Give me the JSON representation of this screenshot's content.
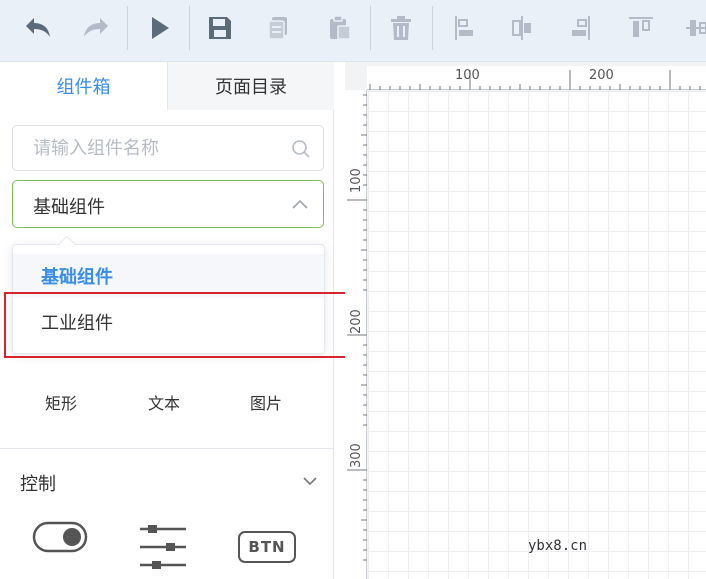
{
  "toolbar": {
    "buttons": [
      {
        "icon": "undo-icon"
      },
      {
        "icon": "redo-icon"
      },
      {
        "icon": "play-icon"
      },
      {
        "icon": "save-icon"
      },
      {
        "icon": "copy-icon"
      },
      {
        "icon": "paste-icon"
      },
      {
        "icon": "delete-icon"
      },
      {
        "icon": "align-left-icon"
      },
      {
        "icon": "align-center-icon"
      },
      {
        "icon": "align-right-icon"
      },
      {
        "icon": "align-top-icon"
      },
      {
        "icon": "align-middle-icon"
      }
    ]
  },
  "left_panel": {
    "tabs": [
      {
        "label": "组件箱",
        "active": true
      },
      {
        "label": "页面目录",
        "active": false
      }
    ],
    "search": {
      "placeholder": "请输入组件名称",
      "value": ""
    },
    "category_select": {
      "value": "基础组件",
      "options": [
        "基础组件",
        "工业组件"
      ],
      "selected_option": "基础组件"
    },
    "basic_components": [
      {
        "label": "矩形",
        "icon": "rectangle-icon"
      },
      {
        "label": "文本",
        "icon": "text-icon"
      },
      {
        "label": "图片",
        "icon": "image-icon"
      }
    ],
    "control_section": {
      "title": "控制",
      "components": [
        {
          "icon": "toggle-switch-icon"
        },
        {
          "icon": "slider-icon"
        },
        {
          "icon": "button-component-icon",
          "text": "BTN"
        }
      ]
    }
  },
  "canvas": {
    "ruler_top_labels": [
      "100",
      "200"
    ],
    "ruler_left_labels": [
      "100",
      "200",
      "300"
    ]
  },
  "watermark": "ybx8.cn",
  "colors": {
    "accent": "#3a8ee6",
    "select_border": "#7fbf5a",
    "highlight_box": "#d9232e",
    "toolbar_bg": "#e9f0f7"
  }
}
